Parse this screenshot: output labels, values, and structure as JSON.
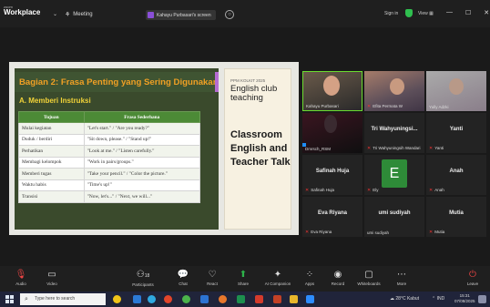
{
  "topbar": {
    "logo_small": "zoom",
    "logo_text": "Workplace",
    "meeting_label": "Meeting",
    "share_label": "Kahayu Purbasari's screen",
    "signin_label": "Sign in",
    "view_label": "View",
    "minimize": "—",
    "maximize": "☐",
    "close": "✕"
  },
  "slide": {
    "title": "Bagian 2: Frasa Penting yang Sering Digunakan",
    "subtitle": "A. Memberi Instruksi",
    "table_headers": [
      "Tujuan",
      "Frasa Sederhana"
    ],
    "rows": [
      [
        "Mulai kegiatan",
        "\"Let's start.\" / \"Are you ready?\""
      ],
      [
        "Duduk / berdiri",
        "\"Sit down, please.\" / \"Stand up!\""
      ],
      [
        "Perhatikan",
        "\"Look at me.\" / \"Listen carefully.\""
      ],
      [
        "Membagi kelompok",
        "\"Work in pairs/groups.\""
      ],
      [
        "Memberi tugas",
        "\"Take your pencil.\" / \"Color the picture.\""
      ],
      [
        "Waktu habis",
        "\"Time's up!\""
      ],
      [
        "Transisi",
        "\"Now, let's...\" / \"Next, we will...\""
      ]
    ],
    "right_small": "PPM KOLKIT 2025",
    "right_club": "English club teaching",
    "right_main": "Classroom English and Teacher Talk"
  },
  "participants": [
    {
      "name": "Kahayu Purbasari",
      "type": "video"
    },
    {
      "name": "Efita Permata W",
      "type": "video"
    },
    {
      "name": "Yully Adzki",
      "type": "video"
    },
    {
      "name": "Dmrsch_RSM",
      "type": "video"
    },
    {
      "name": "Tri Wahyuningsih Wandari",
      "display": "Tri Wahyuningsi...",
      "type": "name"
    },
    {
      "name": "Yanti",
      "display": "Yanti",
      "type": "name"
    },
    {
      "name": "Safinah Huja",
      "display": "Safinah Huja",
      "type": "name"
    },
    {
      "name": "Ely",
      "display": "E",
      "type": "avatar"
    },
    {
      "name": "Anah",
      "display": "Anah",
      "type": "name"
    },
    {
      "name": "Eva Riyana",
      "display": "Eva Riyana",
      "type": "name"
    },
    {
      "name": "umi sudiyah",
      "display": "umi sudiyah",
      "type": "name"
    },
    {
      "name": "Mutia",
      "display": "Mutia",
      "type": "name"
    }
  ],
  "toolbar": {
    "audio": "Audio",
    "video": "Video",
    "participants": "Participants",
    "participants_count": "18",
    "chat": "Chat",
    "react": "React",
    "share": "Share",
    "ai": "AI Companion",
    "apps": "Apps",
    "record": "Record",
    "whiteboards": "Whiteboards",
    "more": "More",
    "leave": "Leave"
  },
  "taskbar": {
    "search_placeholder": "Type here to search",
    "weather": "28°C Kabut",
    "lang": "IND",
    "time": "15:31",
    "date": "07/08/2025"
  }
}
